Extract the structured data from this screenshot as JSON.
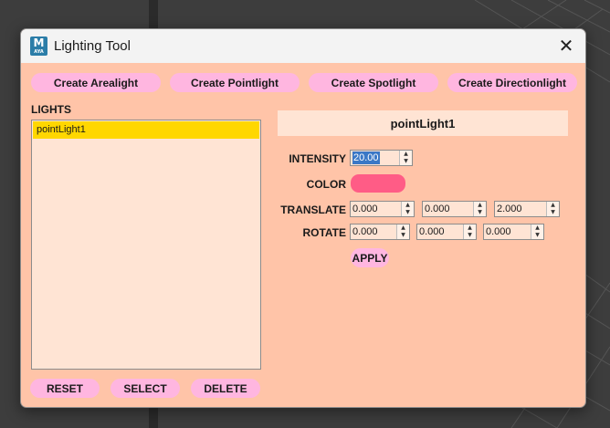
{
  "window": {
    "title": "Lighting Tool",
    "app_icon_letter": "M",
    "app_icon_sub": "AYA",
    "close_glyph": "✕"
  },
  "create_buttons": [
    {
      "label": "Create Arealight"
    },
    {
      "label": "Create Pointlight"
    },
    {
      "label": "Create Spotlight"
    },
    {
      "label": "Create Directionlight"
    }
  ],
  "lights_panel": {
    "label": "LIGHTS",
    "items": [
      {
        "label": "pointLight1",
        "selected": true
      }
    ]
  },
  "bottom_buttons": {
    "reset": "RESET",
    "select": "SELECT",
    "delete": "DELETE"
  },
  "properties": {
    "name": "pointLight1",
    "intensity_label": "INTENSITY",
    "intensity_value": "20.00",
    "color_label": "COLOR",
    "color_value": "#ff5c86",
    "translate_label": "TRANSLATE",
    "translate": [
      "0.000",
      "0.000",
      "2.000"
    ],
    "rotate_label": "ROTATE",
    "rotate": [
      "0.000",
      "0.000",
      "0.000"
    ],
    "apply_label": "APPLY"
  },
  "colors": {
    "dialog_bg": "#ffc4a8",
    "button_bg": "#ffb6e0",
    "field_bg": "#ffe4d4",
    "selection": "#ffd700"
  }
}
